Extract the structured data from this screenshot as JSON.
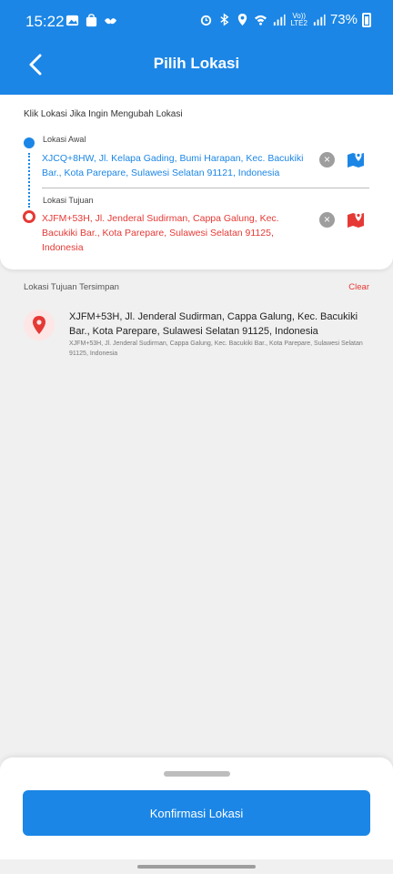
{
  "status_bar": {
    "time": "15:22",
    "network_top": "Vo))",
    "network_bottom": "LTE2",
    "battery": "73%"
  },
  "app_bar": {
    "title": "Pilih Lokasi",
    "back_icon": "chevron-left-icon"
  },
  "route_card": {
    "hint": "Klik Lokasi Jika Ingin Mengubah Lokasi",
    "origin": {
      "label": "Lokasi Awal",
      "address": "XJCQ+8HW, Jl. Kelapa Gading, Bumi Harapan, Kec. Bacukiki Bar., Kota Parepare, Sulawesi Selatan 91121, Indonesia",
      "color": "#1b86e6"
    },
    "destination": {
      "label": "Lokasi Tujuan",
      "address": "XJFM+53H, Jl. Jenderal Sudirman, Cappa Galung, Kec. Bacukiki Bar., Kota Parepare, Sulawesi Selatan 91125, Indonesia",
      "color": "#e53935"
    },
    "clear_icon": "clear-x-icon",
    "map_icon": "map-pin-icon"
  },
  "saved": {
    "heading": "Lokasi Tujuan Tersimpan",
    "clear_label": "Clear",
    "items": [
      {
        "title": "XJFM+53H, Jl. Jenderal Sudirman, Cappa Galung, Kec. Bacukiki Bar., Kota Parepare, Sulawesi Selatan 91125, Indonesia",
        "subtitle": "XJFM+53H, Jl. Jenderal Sudirman, Cappa Galung, Kec. Bacukiki Bar., Kota Parepare, Sulawesi Selatan 91125, Indonesia"
      }
    ]
  },
  "bottom_sheet": {
    "confirm_label": "Konfirmasi Lokasi"
  },
  "colors": {
    "primary": "#1b86e6",
    "danger": "#e53935"
  }
}
